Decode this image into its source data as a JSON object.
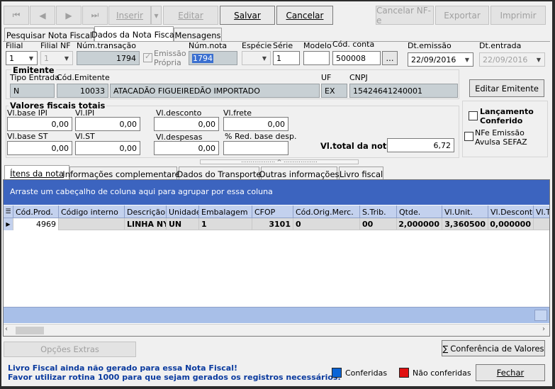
{
  "toolbar": {
    "first": "⏮",
    "prev": "◀",
    "next": "▶",
    "last": "⏭",
    "inserir": "Inserir",
    "editar": "Editar",
    "salvar": "Salvar",
    "cancelar": "Cancelar",
    "cancelar_nfe": "Cancelar NF-e",
    "exportar": "Exportar",
    "imprimir": "Imprimir"
  },
  "tabs": [
    "Pesquisar Nota Fiscal",
    "Dados da Nota Fiscal",
    "Mensagens"
  ],
  "header": {
    "filial_label": "Filial",
    "filial_value": "1",
    "filial_nf_label": "Filial NF",
    "filial_nf_value": "1",
    "num_transacao_label": "Núm.transação",
    "num_transacao_value": "1794",
    "emissao_propria_label": "Emissão Própria",
    "num_nota_label": "Núm.nota",
    "num_nota_value": "1794",
    "especie_label": "Espécie",
    "serie_label": "Série",
    "serie_value": "1",
    "modelo_label": "Modelo",
    "modelo_value": "",
    "cod_conta_label": "Cód. conta",
    "cod_conta_value": "500008",
    "cod_conta_btn": "...",
    "dt_emissao_label": "Dt.emissão",
    "dt_emissao_value": "22/09/2016",
    "dt_entrada_label": "Dt.entrada",
    "dt_entrada_value": "22/09/2016"
  },
  "emitente": {
    "title": "Emitente",
    "tipo_entrada_label": "Tipo Entrada",
    "tipo_entrada_value": "N",
    "cod_label": "Cód.Emitente",
    "cod_value": "10033",
    "nome_value": "ATACADÃO FIGUEIREDÃO IMPORTADO",
    "uf_label": "UF",
    "uf_value": "EX",
    "cnpj_label": "CNPJ",
    "cnpj_value": "15424641240001",
    "edit_button": "Editar Emitente"
  },
  "valores": {
    "title": "Valores fiscais totais",
    "base_ipi_label": "Vl.base IPI",
    "base_ipi": "0,00",
    "ipi_label": "Vl.IPI",
    "ipi": "0,00",
    "desconto_label": "Vl.desconto",
    "desconto": "0,00",
    "frete_label": "Vl.frete",
    "frete": "0,00",
    "base_st_label": "Vl.base ST",
    "base_st": "0,00",
    "st_label": "Vl.ST",
    "st": "0,00",
    "despesas_label": "Vl.despesas",
    "despesas": "0,00",
    "red_base_label": "% Red. base desp.",
    "red_base": "",
    "total_label": "Vl.total da nota:",
    "total": "6,72"
  },
  "checks": {
    "lancamento": "Lançamento Conferido",
    "nfe_avulsa": "NFe Emissão Avulsa SEFAZ"
  },
  "subtabs": [
    "Ítens da nota",
    "Informações complementares",
    "Dados do Transporte",
    "Outras informações",
    "Livro fiscal"
  ],
  "grid": {
    "group_hint": "Arraste um cabeçalho de coluna aqui para agrupar por essa coluna",
    "columns": [
      "Cód.Prod.",
      "Código interno",
      "Descrição",
      "Unidade",
      "Embalagem",
      "CFOP",
      "Cód.Orig.Merc.",
      "S.Trib.",
      "Qtde.",
      "Vl.Unit.",
      "Vl.Desconto",
      "Vl.T"
    ],
    "rows": [
      [
        "4969",
        "",
        "LINHA NYL",
        "UN",
        "1",
        "3101",
        "0",
        "00",
        "2,000000",
        "3,360500",
        "0,000000",
        ""
      ]
    ]
  },
  "footer": {
    "opcoes_extras": "Opções Extras",
    "conferencia": "Conferência de Valores",
    "warning_line1": "Livro Fiscal ainda não gerado para essa Nota Fiscal!",
    "warning_line2": "Favor utilizar rotina 1000 para que sejam gerados os registros necessários.",
    "legend_conferidas": "Conferidas",
    "legend_nao_conferidas": "Não conferidas",
    "fechar": "Fechar",
    "color_conferidas": "#0a64d6",
    "color_nao_conferidas": "#e01010"
  }
}
